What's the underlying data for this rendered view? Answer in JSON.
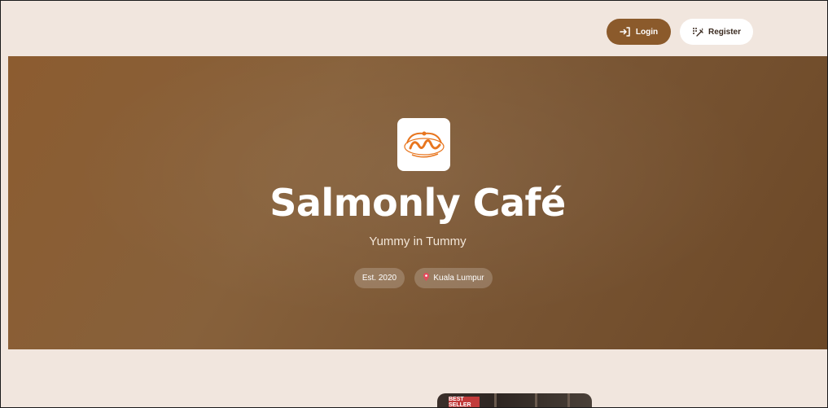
{
  "header": {
    "login_label": "Login",
    "register_label": "Register"
  },
  "hero": {
    "logo_text": "Salmonly",
    "title": "Salmonly Café",
    "tagline": "Yummy in Tummy",
    "badges": {
      "established": "Est. 2020",
      "location": "Kuala Lumpur"
    }
  },
  "preview": {
    "tag_text": "BEST SELLER"
  },
  "colors": {
    "background": "#f1e6de",
    "brand_brown": "#8b5a2b",
    "hero_gradient_start": "#8c5c30",
    "hero_gradient_end": "#6b4726",
    "logo_orange": "#e8761f"
  }
}
